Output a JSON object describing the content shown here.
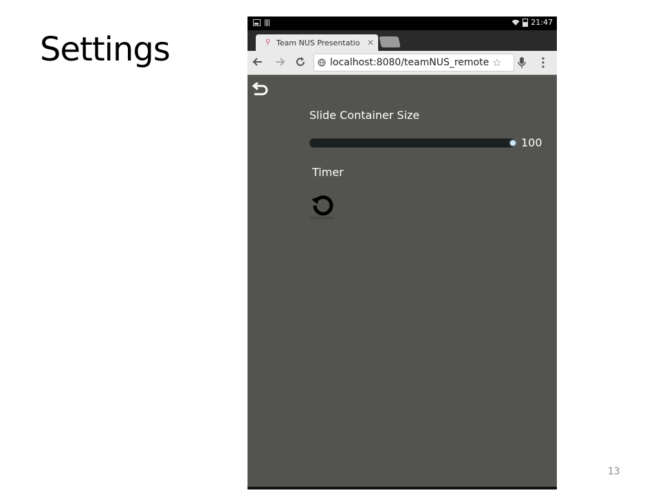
{
  "slide": {
    "title": "Settings",
    "page_number": "13"
  },
  "status_bar": {
    "time": "21:47"
  },
  "browser": {
    "tab_title": "Team NUS Presentatio",
    "tab_close": "✕",
    "url": "localhost:8080/teamNUS_remote."
  },
  "settings": {
    "slide_container_size_label": "Slide Container Size",
    "slide_container_size_value": "100",
    "slider_fraction": 1.0,
    "timer_label": "Timer"
  },
  "colors": {
    "app_background": "#535350",
    "slider_track": "#1a1f22",
    "slider_thumb": "#cfe8f6"
  },
  "icons": [
    "image-icon",
    "barcode-icon",
    "wifi-icon",
    "battery-icon",
    "favicon-icon",
    "back-icon",
    "forward-icon",
    "reload-icon",
    "globe-icon",
    "star-icon",
    "mic-icon",
    "menu-icon",
    "back-arrow-icon",
    "reset-icon"
  ]
}
